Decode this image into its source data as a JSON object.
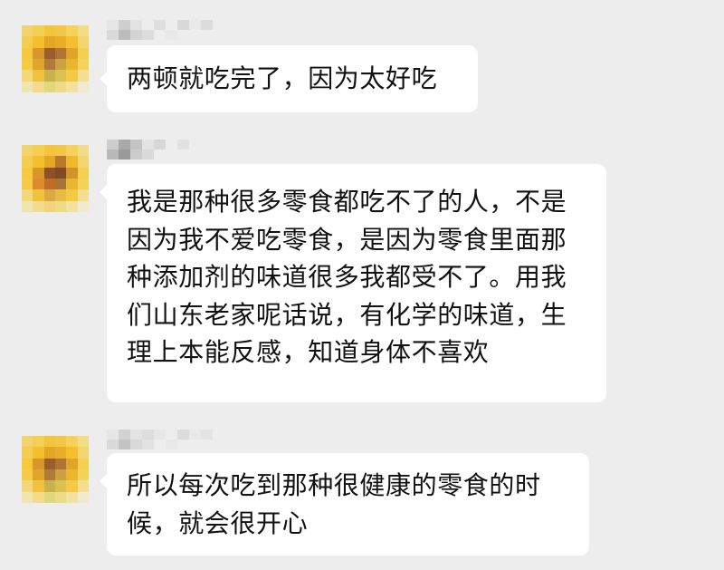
{
  "messages": [
    {
      "sender": "",
      "text": "两顿就吃完了，因为太好吃"
    },
    {
      "sender": "",
      "text": "我是那种很多零食都吃不了的人，不是因为我不爱吃零食，是因为零食里面那种添加剂的味道很多我都受不了。用我们山东老家呢话说，有化学的味道，生理上本能反感，知道身体不喜欢"
    },
    {
      "sender": "",
      "text": "所以每次吃到那种很健康的零食的时候，就会很开心"
    }
  ],
  "colors": {
    "background": "#ededed",
    "bubble": "#ffffff",
    "text": "#111111"
  },
  "icons": {
    "avatar": "pixelated-avatar-icon"
  }
}
